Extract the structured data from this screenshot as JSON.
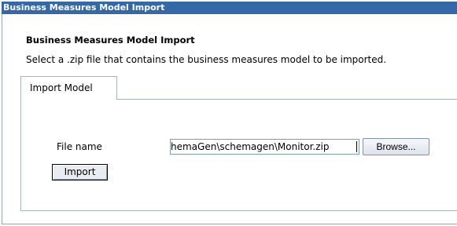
{
  "window": {
    "title": "Business Measures Model Import"
  },
  "page": {
    "heading": "Business Measures Model Import",
    "description": "Select a .zip file that contains the business measures model to be imported."
  },
  "tabs": [
    {
      "label": "Import Model",
      "selected": true
    }
  ],
  "form": {
    "file_label": "File name",
    "file_value": "hemaGen\\schemagen\\Monitor.zip",
    "browse_label": "Browse...",
    "import_label": "Import"
  },
  "colors": {
    "titlebar": "#3568a8",
    "border": "#aab3c2"
  }
}
